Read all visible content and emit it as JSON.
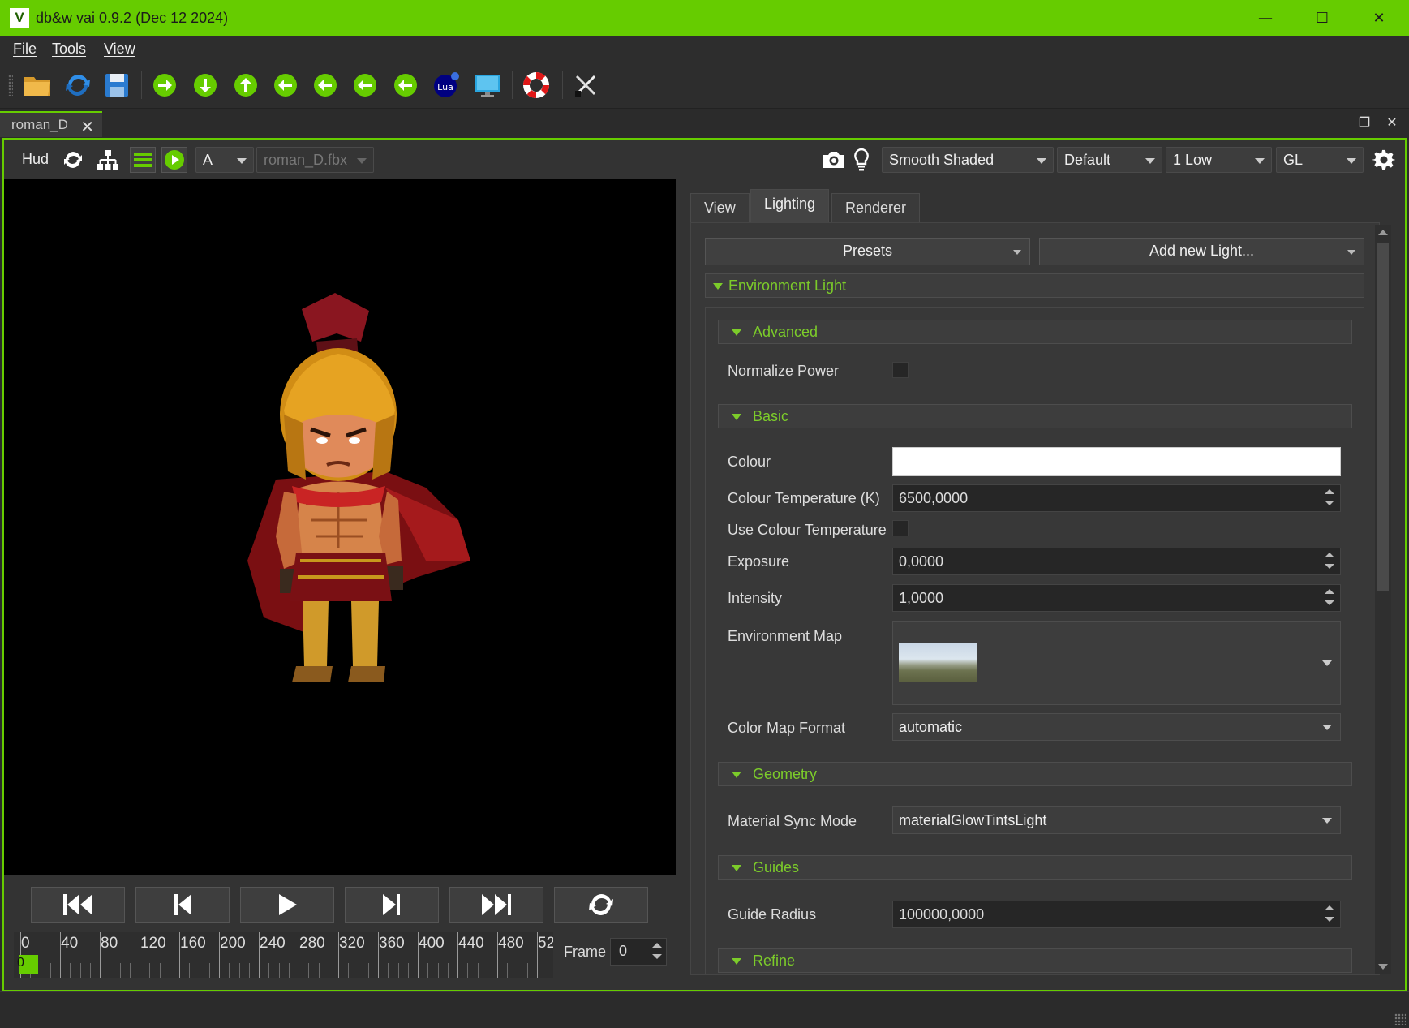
{
  "window": {
    "logo_text": "V",
    "title": "db&w vai 0.9.2 (Dec 12 2024)",
    "minimize": "—",
    "maximize": "☐",
    "close": "✕"
  },
  "menu": [
    "File",
    "Tools",
    "View"
  ],
  "toolbar_icons": [
    "open-folder-icon",
    "reload-icon",
    "save-icon",
    "arrow-right-icon",
    "arrow-down-icon",
    "arrow-up-icon",
    "arrow-left-icon",
    "arrow-left-icon",
    "arrow-left-icon",
    "arrow-left-icon",
    "lua-icon",
    "monitor-icon",
    "lifebuoy-icon",
    "tools-icon"
  ],
  "lua_label": "Lua",
  "document_tab": {
    "label": "roman_D",
    "close": "✕"
  },
  "dock": {
    "float": "❐",
    "close": "✕"
  },
  "viewport_header": {
    "hud_label": "Hud",
    "animation_combo": "A",
    "file_combo": "roman_D.fbx",
    "shading_combo": "Smooth Shaded",
    "profile_combo": "Default",
    "quality_combo": "1 Low",
    "api_combo": "GL"
  },
  "playback": {
    "timeline_labels": [
      "0",
      "40",
      "80",
      "120",
      "160",
      "200",
      "240",
      "280",
      "320",
      "360",
      "400",
      "440",
      "480",
      "52"
    ],
    "cursor_value": "0",
    "frame_label": "Frame",
    "frame_value": "0"
  },
  "right_panel": {
    "tabs": [
      "View",
      "Lighting",
      "Renderer"
    ],
    "active_tab": "Lighting",
    "presets_button": "Presets",
    "add_light_button": "Add new Light...",
    "sections": {
      "environment_light": "Environment Light",
      "advanced": "Advanced",
      "basic": "Basic",
      "geometry": "Geometry",
      "guides": "Guides",
      "refine": "Refine"
    },
    "properties": {
      "normalize_power": {
        "label": "Normalize Power",
        "checked": false
      },
      "colour": {
        "label": "Colour",
        "value": "#ffffff"
      },
      "colour_temperature": {
        "label": "Colour Temperature (K)",
        "value": "6500,0000"
      },
      "use_colour_temperature": {
        "label": "Use Colour Temperature",
        "checked": false
      },
      "exposure": {
        "label": "Exposure",
        "value": "0,0000"
      },
      "intensity": {
        "label": "Intensity",
        "value": "1,0000"
      },
      "environment_map": {
        "label": "Environment Map"
      },
      "color_map_format": {
        "label": "Color Map Format",
        "value": "automatic"
      },
      "material_sync_mode": {
        "label": "Material Sync Mode",
        "value": "materialGlowTintsLight"
      },
      "guide_radius": {
        "label": "Guide Radius",
        "value": "100000,0000"
      }
    }
  },
  "colors": {
    "accent": "#66cc00",
    "section_text": "#7ccc2a",
    "background": "#333333"
  }
}
